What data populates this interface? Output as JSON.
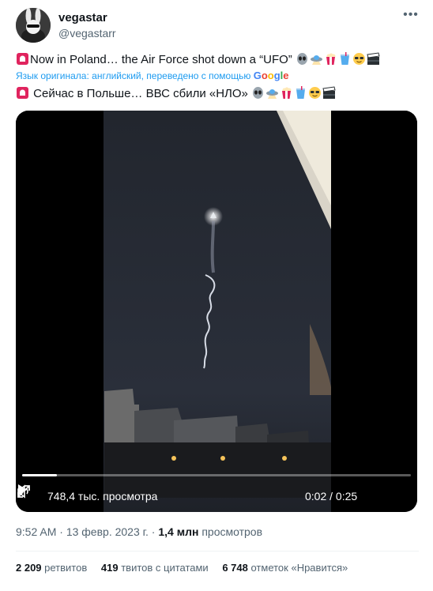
{
  "author": {
    "name": "vegastar",
    "handle": "@vegastarr"
  },
  "tweet": {
    "text_en": "Now in Poland… the Air Force shot down a “UFO”",
    "translation_note": "Язык оригинала: английский, переведено с помощью",
    "translation_brand": "Google",
    "text_ru": "Сейчас в Польше… ВВС сбили «НЛО»",
    "emojis_en": [
      "siren-icon",
      "alien-icon",
      "flying-saucer-icon",
      "popcorn-icon",
      "cup-icon",
      "sunglasses-icon",
      "clapper-icon"
    ],
    "emojis_ru": [
      "siren-icon",
      "alien-icon",
      "flying-saucer-icon",
      "popcorn-icon",
      "cup-icon",
      "sunglasses-icon",
      "clapper-icon"
    ]
  },
  "video": {
    "views": "748,4 тыс. просмотра",
    "time": "0:02 / 0:25",
    "progress": 0.09
  },
  "meta": {
    "time": "9:52 AM",
    "sep1": " · ",
    "date": "13 февр. 2023 г.",
    "sep2": " · ",
    "views_count": "1,4 млн",
    "views_label": " просмотров"
  },
  "stats": {
    "retweets_count": "2 209",
    "retweets_label": " ретвитов",
    "quotes_count": "419",
    "quotes_label": " твитов с цитатами",
    "likes_count": "6 748",
    "likes_label": " отметок «Нравится»"
  },
  "colors": {
    "accent": "#1d9bf0",
    "secondary": "#536471",
    "text": "#0f1419"
  }
}
